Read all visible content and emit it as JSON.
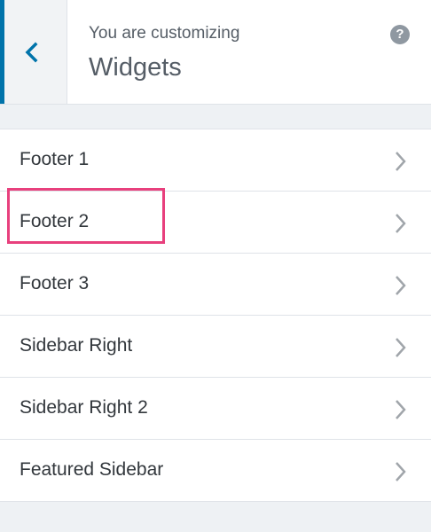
{
  "header": {
    "back_icon": "chevron-left-icon",
    "customizing_label": "You are customizing",
    "section_title": "Widgets",
    "help_icon": "question-circle-icon",
    "help_glyph": "?"
  },
  "sections": [
    {
      "label": "Footer 1",
      "name": "section-footer-1"
    },
    {
      "label": "Footer 2",
      "name": "section-footer-2"
    },
    {
      "label": "Footer 3",
      "name": "section-footer-3"
    },
    {
      "label": "Sidebar Right",
      "name": "section-sidebar-right",
      "highlighted": true
    },
    {
      "label": "Sidebar Right 2",
      "name": "section-sidebar-right-2"
    },
    {
      "label": "Featured Sidebar",
      "name": "section-featured-sidebar"
    }
  ],
  "colors": {
    "accent": "#0073aa",
    "highlight": "#e8407d",
    "panel_bg": "#eef1f4"
  }
}
